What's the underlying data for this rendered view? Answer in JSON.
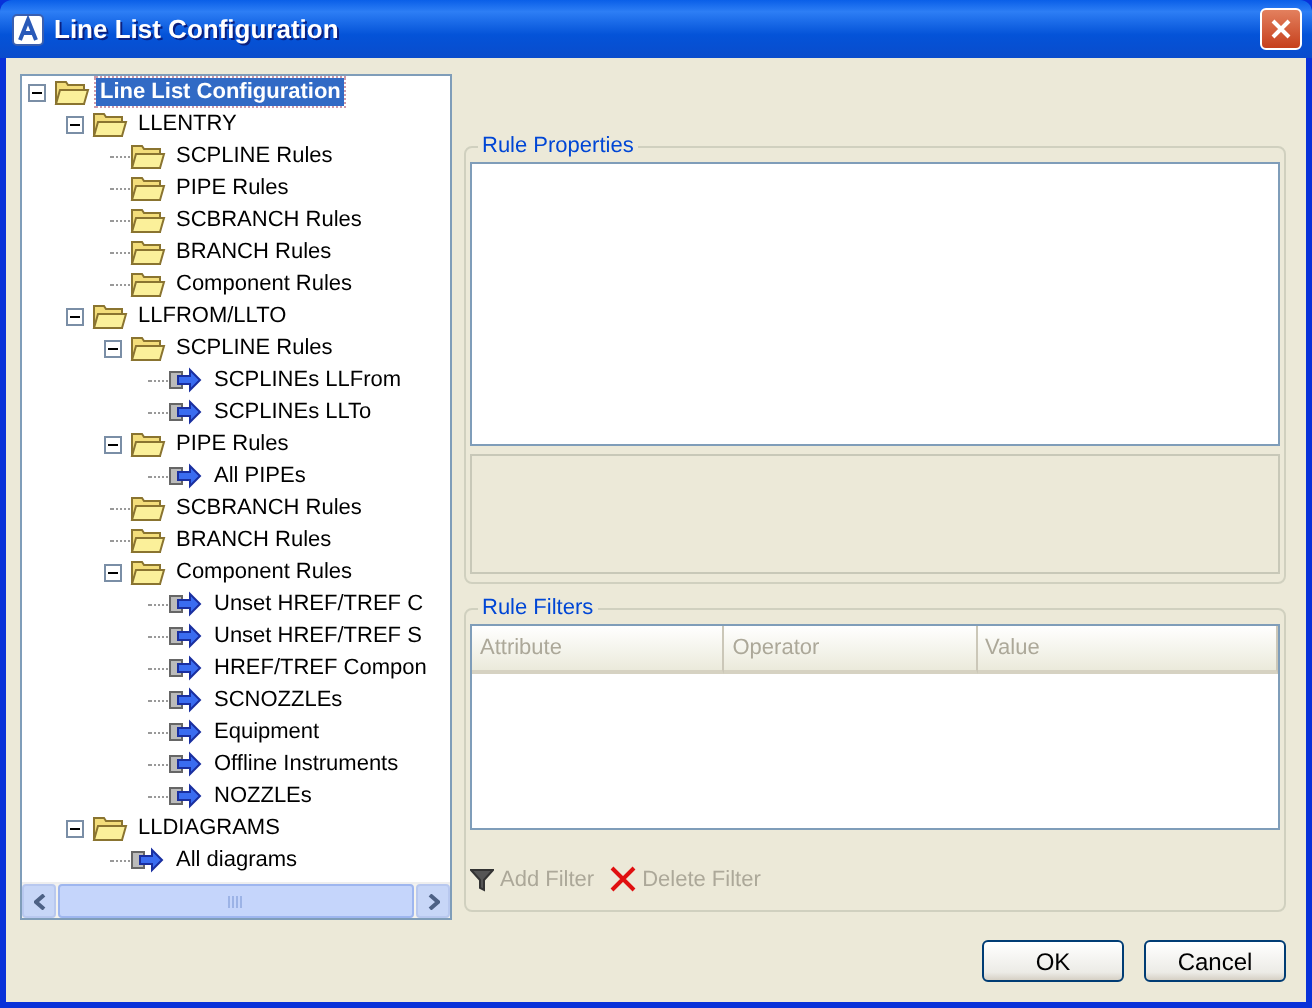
{
  "window": {
    "title": "Line List Configuration"
  },
  "tree": {
    "label": "Line List Configuration",
    "kind": "folder",
    "selected": true,
    "expanded": true,
    "children": [
      {
        "label": "LLENTRY",
        "kind": "folder",
        "selected": false,
        "expanded": true,
        "children": [
          {
            "label": "SCPLINE Rules",
            "kind": "folder",
            "selected": false
          },
          {
            "label": "PIPE Rules",
            "kind": "folder",
            "selected": false
          },
          {
            "label": "SCBRANCH Rules",
            "kind": "folder",
            "selected": false
          },
          {
            "label": "BRANCH Rules",
            "kind": "folder",
            "selected": false
          },
          {
            "label": "Component Rules",
            "kind": "folder",
            "selected": false
          }
        ]
      },
      {
        "label": "LLFROM/LLTO",
        "kind": "folder",
        "selected": false,
        "expanded": true,
        "children": [
          {
            "label": "SCPLINE Rules",
            "kind": "folder",
            "selected": false,
            "expanded": true,
            "children": [
              {
                "label": "SCPLINEs LLFrom",
                "kind": "rule",
                "selected": false
              },
              {
                "label": "SCPLINEs LLTo",
                "kind": "rule",
                "selected": false
              }
            ]
          },
          {
            "label": "PIPE Rules",
            "kind": "folder",
            "selected": false,
            "expanded": true,
            "children": [
              {
                "label": "All PIPEs",
                "kind": "rule",
                "selected": false
              }
            ]
          },
          {
            "label": "SCBRANCH Rules",
            "kind": "folder",
            "selected": false
          },
          {
            "label": "BRANCH Rules",
            "kind": "folder",
            "selected": false
          },
          {
            "label": "Component Rules",
            "kind": "folder",
            "selected": false,
            "expanded": true,
            "children": [
              {
                "label": "Unset HREF/TREF C",
                "kind": "rule",
                "selected": false
              },
              {
                "label": "Unset HREF/TREF S",
                "kind": "rule",
                "selected": false
              },
              {
                "label": "HREF/TREF Compon",
                "kind": "rule",
                "selected": false
              },
              {
                "label": "SCNOZZLEs",
                "kind": "rule",
                "selected": false
              },
              {
                "label": "Equipment",
                "kind": "rule",
                "selected": false
              },
              {
                "label": "Offline Instruments",
                "kind": "rule",
                "selected": false
              },
              {
                "label": "NOZZLEs",
                "kind": "rule",
                "selected": false
              }
            ]
          }
        ]
      },
      {
        "label": "LLDIAGRAMS",
        "kind": "folder",
        "selected": false,
        "expanded": true,
        "children": [
          {
            "label": "All diagrams",
            "kind": "rule",
            "selected": false
          }
        ]
      }
    ]
  },
  "rule_properties": {
    "title": "Rule Properties"
  },
  "rule_filters": {
    "title": "Rule Filters",
    "columns": [
      "Attribute",
      "Operator",
      "Value"
    ],
    "actions": [
      {
        "label": "Add Filter",
        "kind": "add",
        "disabled": true
      },
      {
        "label": "Delete Filter",
        "kind": "delete",
        "disabled": true
      }
    ]
  },
  "buttons": [
    "OK",
    "Cancel"
  ]
}
